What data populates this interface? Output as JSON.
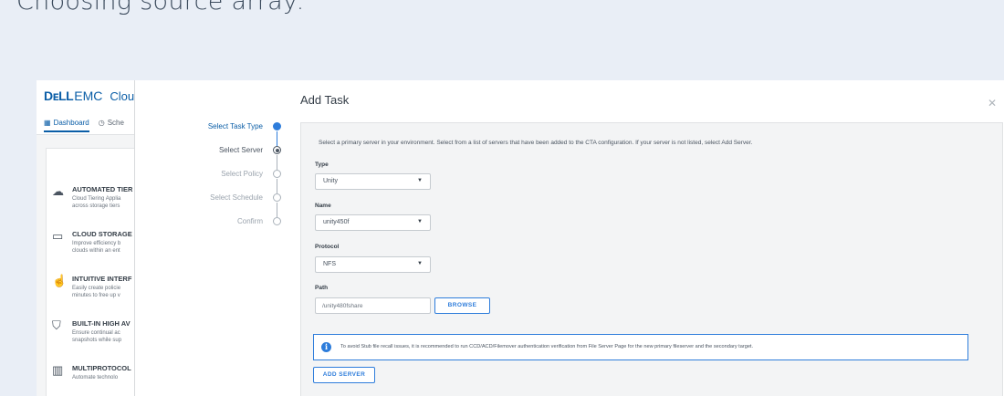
{
  "slide": {
    "title": "Choosing source array:"
  },
  "background_app": {
    "logo": "DᴇLL",
    "logo_suffix": "EMC",
    "app_name": "Clou",
    "tabs": [
      {
        "label": "Dashboard",
        "icon": "dashboard-icon"
      },
      {
        "label": "Sche",
        "icon": "clock-icon"
      }
    ],
    "features": [
      {
        "title": "AUTOMATED TIER",
        "desc_1": "Cloud Tiering Applia",
        "desc_2": "across storage tiers",
        "icon": "cloud-sync-icon"
      },
      {
        "title": "CLOUD STORAGE",
        "desc_1": "Improve efficiency b",
        "desc_2": "clouds within an ent",
        "icon": "folder-cloud-icon"
      },
      {
        "title": "INTUITIVE INTERF",
        "desc_1": "Easily create policie",
        "desc_2": "minutes to free up v",
        "icon": "hand-pointer-icon"
      },
      {
        "title": "BUILT-IN HIGH AV",
        "desc_1": "Ensure continual ac",
        "desc_2": "snapshots while sup",
        "icon": "shield-icon"
      },
      {
        "title": "MULTIPROTOCOL",
        "desc_1": "Automate technolo",
        "desc_2": "",
        "icon": "server-stack-icon"
      }
    ]
  },
  "dialog": {
    "title": "Add Task",
    "close_icon": "close-icon",
    "steps": [
      {
        "label": "Select Task Type",
        "state": "active"
      },
      {
        "label": "Select Server",
        "state": "current"
      },
      {
        "label": "Select Policy",
        "state": "pending"
      },
      {
        "label": "Select Schedule",
        "state": "pending"
      },
      {
        "label": "Confirm",
        "state": "pending"
      }
    ],
    "intro": "Select a primary server in your environment. Select from a list of servers that have been added to the CTA configuration. If your server is not listed, select Add Server.",
    "type": {
      "label": "Type",
      "value": "Unity"
    },
    "name": {
      "label": "Name",
      "value": "unity450f"
    },
    "protocol": {
      "label": "Protocol",
      "value": "NFS"
    },
    "path": {
      "label": "Path",
      "value": "/unity480fshare",
      "browse_label": "BROWSE"
    },
    "info": "To avoid Stub file recall issues, it is recommended to run CCD/ACD/Filemover authentication verification from File Server Page for the new primary fileserver and the secondary target.",
    "add_server_label": "ADD SERVER"
  },
  "colors": {
    "accent": "#2e7ddb",
    "brand": "#0b5ea7",
    "page_bg": "#e9eef6"
  }
}
